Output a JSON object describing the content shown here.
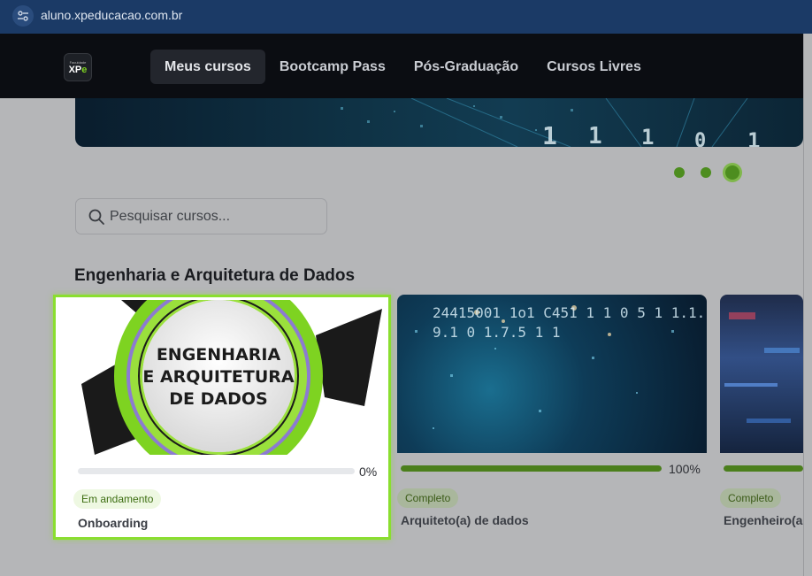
{
  "browser": {
    "url": "aluno.xpeducacao.com.br",
    "site_info_icon": "tune-icon"
  },
  "header": {
    "logo_small": "Faculdade",
    "logo_text": "XP",
    "logo_accent": "e",
    "nav": [
      {
        "label": "Meus cursos",
        "active": true
      },
      {
        "label": "Bootcamp Pass",
        "active": false
      },
      {
        "label": "Pós-Graduação",
        "active": false
      },
      {
        "label": "Cursos Livres",
        "active": false
      }
    ]
  },
  "carousel": {
    "slides": 3,
    "active_index": 2,
    "digits": [
      "1",
      "1",
      "1",
      "1",
      "0",
      "1"
    ]
  },
  "search": {
    "placeholder": "Pesquisar cursos...",
    "value": "",
    "icon": "search-icon"
  },
  "section": {
    "title": "Engenharia e Arquitetura de Dados"
  },
  "courses": [
    {
      "title": "Onboarding",
      "status": "Em andamento",
      "progress_label": "0%",
      "progress": 0,
      "selected": true,
      "thumb_text": [
        "ENGENHARIA",
        "E ARQUITETURA",
        "DE DADOS"
      ]
    },
    {
      "title": "Arquiteto(a) de dados",
      "status": "Completo",
      "progress_label": "100%",
      "progress": 100,
      "selected": false,
      "thumb_digits": "24415001 1o1 C451 1 1 0 5 1 1.1.9.1 0 1.7.5 1 1"
    },
    {
      "title": "Engenheiro(a",
      "status": "Completo",
      "progress_label": "",
      "progress": 100,
      "selected": false
    }
  ],
  "colors": {
    "accent_green": "#8ade2f",
    "progress_green": "#4b7f1c",
    "header_bg": "#0b0d12",
    "address_bar_bg": "#1b3a66"
  }
}
